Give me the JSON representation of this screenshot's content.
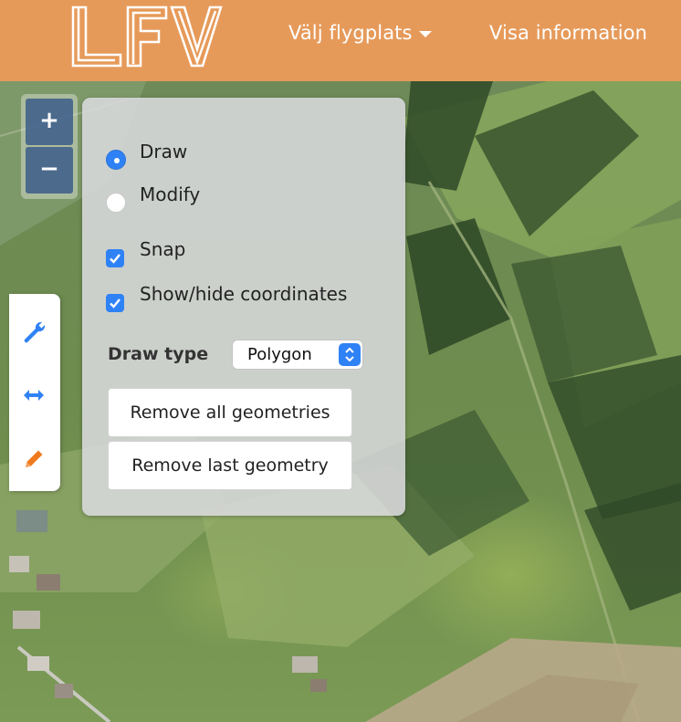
{
  "navbar": {
    "logo_text": "LFV",
    "airport_menu_label": "Välj flygplats",
    "info_link_label": "Visa information",
    "background_color": "#e69a5a"
  },
  "zoom": {
    "zoom_in_label": "+",
    "zoom_out_label": "−"
  },
  "toolbar": {
    "tools": [
      {
        "icon": "wrench-icon",
        "color": "#2f82f5"
      },
      {
        "icon": "horizontal-arrows-icon",
        "color": "#2f82f5"
      },
      {
        "icon": "pencil-icon",
        "color": "#f07b1e"
      }
    ]
  },
  "draw_panel": {
    "mode_options": [
      {
        "label": "Draw",
        "selected": true
      },
      {
        "label": "Modify",
        "selected": false
      }
    ],
    "snap_label": "Snap",
    "snap_checked": true,
    "coords_label": "Show/hide coordinates",
    "coords_checked": true,
    "draw_type_label": "Draw type",
    "draw_type_value": "Polygon",
    "remove_all_label": "Remove all geometries",
    "remove_last_label": "Remove last geometry",
    "accent_color": "#2f82f5"
  }
}
